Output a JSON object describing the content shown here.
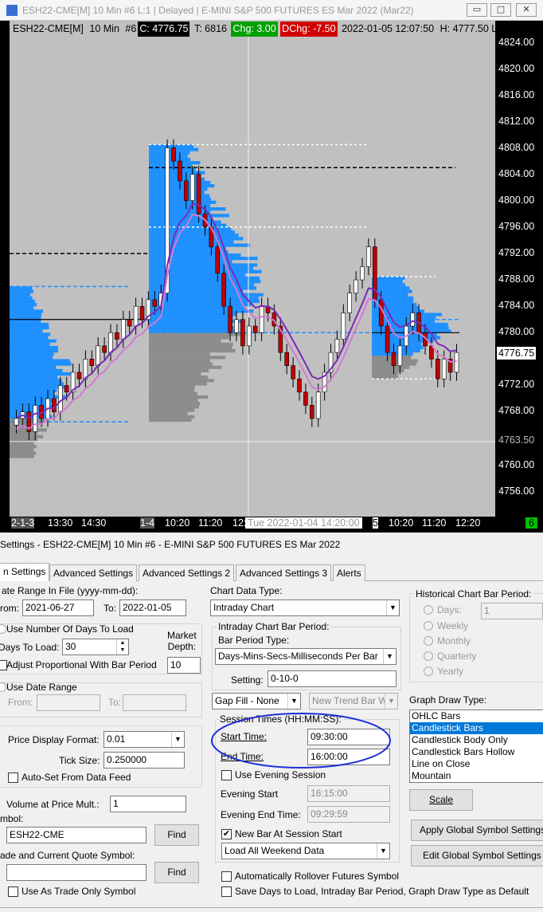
{
  "window": {
    "title": "ESH22-CME[M]  10 Min  #6 L:1 | Delayed | E-MINI S&P 500 FUTURES ES Mar 2022 (Mar22)",
    "min": "▭",
    "max": "□",
    "close": "✕"
  },
  "chart_header": {
    "symbol": "ESH22-CME[M]",
    "interval": "10 Min",
    "num": "#6",
    "close": "C: 4776.75",
    "trades": "T: 6816",
    "chg": "Chg: 3.00",
    "dchg": "DChg: -7.50",
    "datetime": "2022-01-05  12:07:50",
    "high": "H: 4777.50 L:"
  },
  "colors": {
    "chart_bg": "#c0c0c0",
    "profile_blue": "#1e90ff",
    "profile_gray": "#8c8c8c",
    "ma_purple": "#7a2bb5",
    "ma_pink": "#d27ad2",
    "up_candle": "#ffffff",
    "down_candle": "#c00000",
    "chg_bg": "#00a000",
    "dchg_bg": "#d00000"
  },
  "price_axis": {
    "ticks": [
      "4824.00",
      "4820.00",
      "4816.00",
      "4812.00",
      "4808.00",
      "4804.00",
      "4800.00",
      "4796.00",
      "4792.00",
      "4788.00",
      "4784.00",
      "4780.00",
      "4776.75",
      "4772.00",
      "4768.00",
      "4763.50",
      "4760.00",
      "4756.00"
    ]
  },
  "time_axis": {
    "labels": [
      "2-1-3",
      "13:30",
      "14:30",
      "1-4",
      "10:20",
      "11:20",
      "12:",
      "Tue 2022-01-04  14:20:00",
      "5",
      "10:20",
      "11:20",
      "12:20",
      "6"
    ]
  },
  "settings": {
    "title": "Settings - ESH22-CME[M]  10 Min  #6 - E-MINI S&P 500 FUTURES ES Mar 2022",
    "tabs": [
      "n Settings",
      "Advanced Settings",
      "Advanced Settings 2",
      "Advanced Settings 3",
      "Alerts"
    ],
    "date_range_label": "ate Range In File (yyyy-mm-dd):",
    "from_label": "rom:",
    "from_value": "2021-06-27",
    "to_label": "To:",
    "to_value": "2022-01-05",
    "use_num_days_label": "Use Number Of Days To Load",
    "days_to_load_label": "Days To Load:",
    "days_to_load_value": "30",
    "market_depth_label": "Market\nDepth:",
    "market_depth_value": "10",
    "adjust_label": "Adjust Proportional With Bar Period",
    "use_date_range_label": "Use Date Range",
    "dr_from": "From:",
    "dr_to": "To:",
    "price_format_label": "Price Display Format:",
    "price_format_value": "0.01",
    "tick_size_label": "Tick Size:",
    "tick_size_value": "0.250000",
    "auto_set_label": "Auto-Set From Data Feed",
    "vap_label": "Volume at Price Mult.:",
    "vap_value": "1",
    "symbol_label": "mbol:",
    "symbol_value": "ESH22-CME",
    "find": "Find",
    "trade_symbol_label": "ade and Current Quote Symbol:",
    "trade_find": "Find",
    "trade_only_label": "Use As Trade Only Symbol",
    "chart_data_type_label": "Chart Data Type:",
    "chart_data_type_value": "Intraday Chart",
    "intraday_period_label": "Intraday Chart Bar Period:",
    "bar_period_type_label": "Bar Period Type:",
    "bar_period_type_value": "Days-Mins-Secs-Milliseconds Per Bar",
    "setting_label": "Setting:",
    "setting_value": "0-10-0",
    "gap_fill_value": "Gap Fill - None",
    "new_trend_value": "New Trend Bar W",
    "session_times_label": "Session Times (HH:MM:SS):",
    "start_time_label": "Start Time:",
    "start_time_value": "09:30:00",
    "end_time_label": "End Time:",
    "end_time_value": "16:00:00",
    "use_evening_label": "Use Evening Session",
    "evening_start_label": "Evening Start",
    "evening_start_value": "16:15:00",
    "evening_end_label": "Evening End Time:",
    "evening_end_value": "09:29:59",
    "new_bar_label": "New Bar At Session Start",
    "load_weekend_value": "Load All Weekend Data",
    "auto_rollover_label": "Automatically Rollover Futures Symbol",
    "save_days_label": "Save Days to Load, Intraday Bar Period, Graph Draw Type as Default",
    "hist_period_label": "Historical Chart Bar Period:",
    "hist_options": [
      "Days:",
      "Weekly",
      "Monthly",
      "Quarterly",
      "Yearly"
    ],
    "hist_days_value": "1",
    "graph_draw_label": "Graph Draw Type:",
    "graph_draw_options": [
      "OHLC Bars",
      "Candlestick Bars",
      "Candlestick Body Only",
      "Candlestick Bars Hollow",
      "Line on Close",
      "Mountain"
    ],
    "scale_btn": "Scale",
    "apply_global_btn": "Apply Global Symbol Settings",
    "edit_global_btn": "Edit Global Symbol Settings"
  }
}
